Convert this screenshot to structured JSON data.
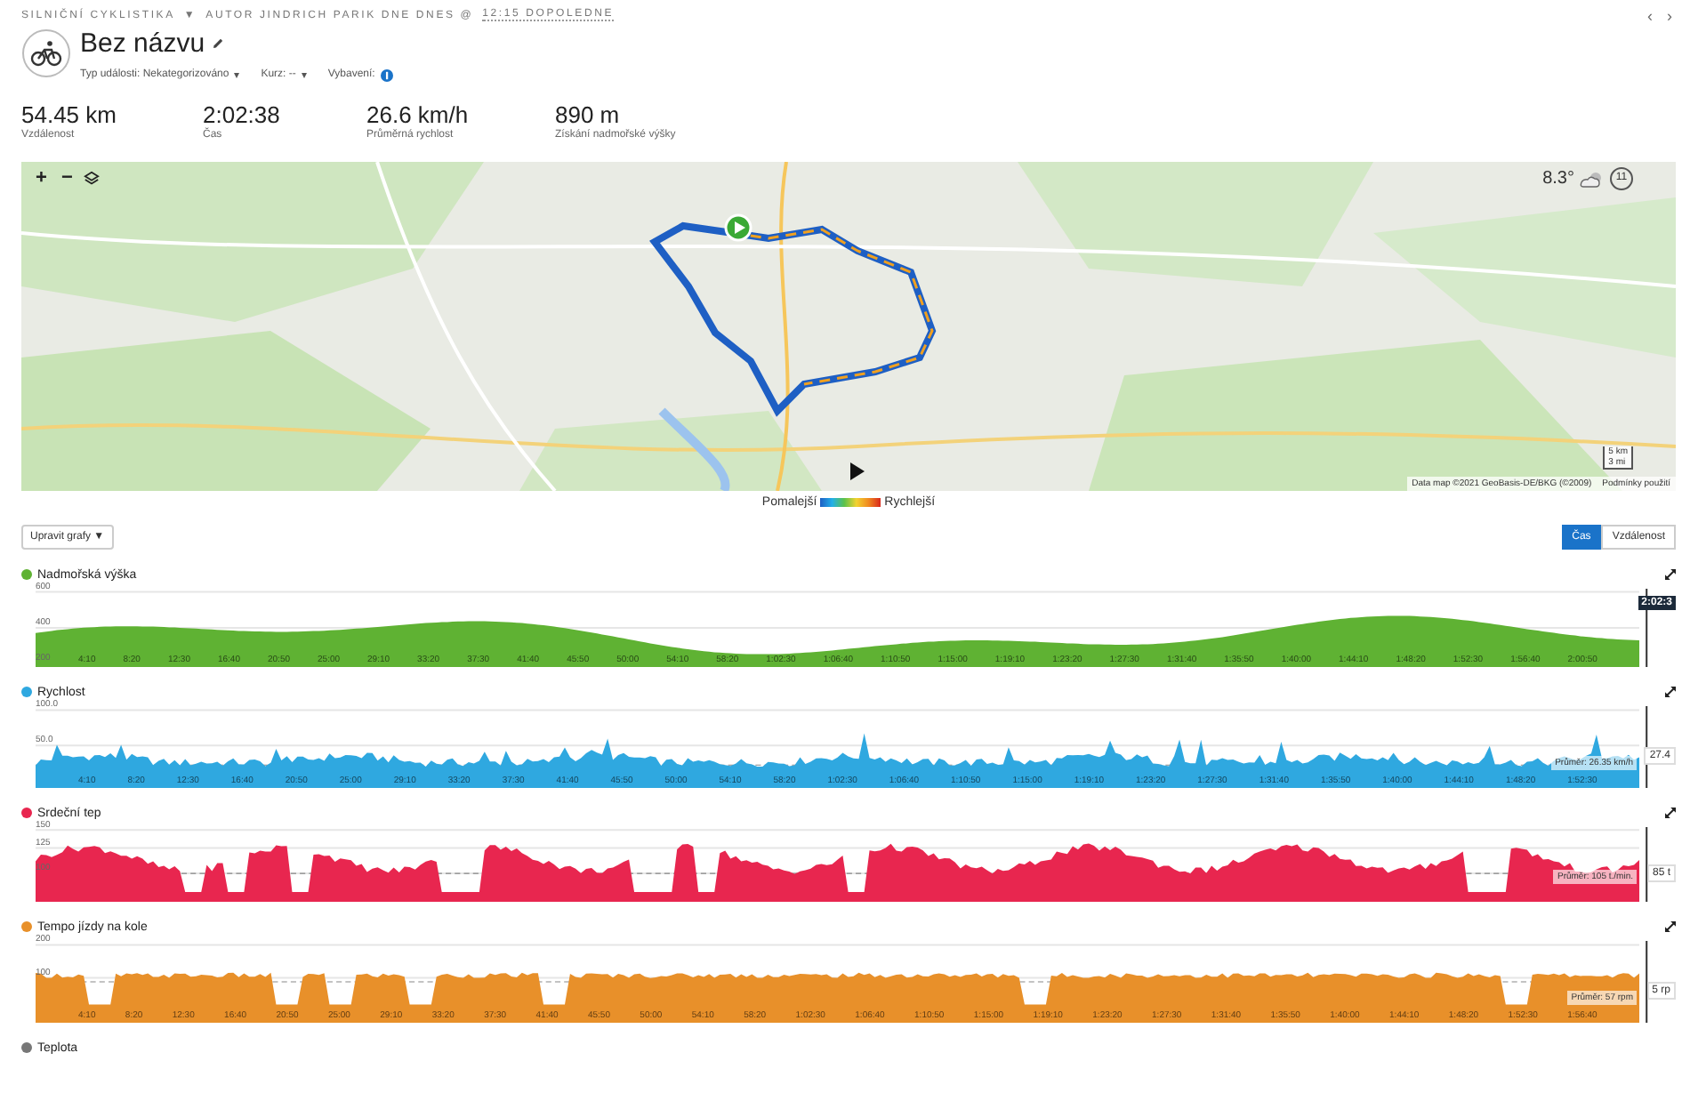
{
  "activity": {
    "type": "SILNIČNÍ CYKLISTIKA",
    "type_caret": "▼",
    "author": "AUTOR JINDRICH PARIK DNE DNES @",
    "time": "12:15 DOPOLEDNE",
    "title": "Bez názvu",
    "meta": [
      {
        "label": "Typ události: Nekategorizováno",
        "caret": "▾"
      },
      {
        "label": "Kurz: --",
        "caret": "▾"
      },
      {
        "label": "Vybavení:"
      }
    ],
    "pager": [
      "‹",
      "›"
    ]
  },
  "stats": [
    {
      "value": "54.45 km",
      "label": "Vzdálenost"
    },
    {
      "value": "2:02:38",
      "label": "Čas"
    },
    {
      "value": "26.6 km/h",
      "label": "Průměrná rychlost"
    },
    {
      "value": "890 m",
      "label": "Získání nadmořské výšky"
    }
  ],
  "map": {
    "zoom_in": "+",
    "zoom_out": "−",
    "temperature": "8.3°",
    "wind": "11",
    "scale": [
      "5 km",
      "3 mi"
    ],
    "attribution": "Data map ©2021 GeoBasis-DE/BKG (©2009)",
    "terms": "Podmínky použití"
  },
  "legend": {
    "slow": "Pomalejší",
    "fast": "Rychlejší"
  },
  "edit_button": {
    "label": "Upravit grafy",
    "caret": "▼"
  },
  "axis_toggle": [
    {
      "label": "Čas",
      "selected": true
    },
    {
      "label": "Vzdálenost",
      "selected": false
    }
  ],
  "charts": [
    {
      "kind": "elevation",
      "title": "Nadmořská výška",
      "color": "#5fb233",
      "y_ticks": [
        "600",
        "400",
        "200"
      ],
      "x_ticks": [
        "4:10",
        "8:20",
        "12:30",
        "16:40",
        "20:50",
        "25:00",
        "29:10",
        "33:20",
        "37:30",
        "41:40",
        "45:50",
        "50:00",
        "54:10",
        "58:20",
        "1:02:30",
        "1:06:40",
        "1:10:50",
        "1:15:00",
        "1:19:10",
        "1:23:20",
        "1:27:30",
        "1:31:40",
        "1:35:50",
        "1:40:00",
        "1:44:10",
        "1:48:20",
        "1:52:30",
        "1:56:40",
        "2:00:50"
      ],
      "cursor_value": "2:02:3"
    },
    {
      "kind": "speed",
      "title": "Rychlost",
      "color": "#2fa8e0",
      "y_ticks": [
        "100.0",
        "50.0"
      ],
      "x_ticks": [
        "4:10",
        "8:20",
        "12:30",
        "16:40",
        "20:50",
        "25:00",
        "29:10",
        "33:20",
        "37:30",
        "41:40",
        "45:50",
        "50:00",
        "54:10",
        "58:20",
        "1:02:30",
        "1:06:40",
        "1:10:50",
        "1:15:00",
        "1:19:10",
        "1:23:20",
        "1:27:30",
        "1:31:40",
        "1:35:50",
        "1:40:00",
        "1:44:10",
        "1:48:20",
        "1:52:30"
      ],
      "cursor_value": "27.4",
      "average": "Průměr: 26.35 km/h"
    },
    {
      "kind": "heart_rate",
      "title": "Srdeční tep",
      "color": "#e8264f",
      "y_ticks": [
        "150",
        "125",
        "100"
      ],
      "cursor_value": "85 t",
      "average": "Průměr: 105 t./min."
    },
    {
      "kind": "cadence",
      "title": "Tempo jízdy na kole",
      "color": "#e8902a",
      "y_ticks": [
        "200",
        "100"
      ],
      "x_ticks": [
        "4:10",
        "8:20",
        "12:30",
        "16:40",
        "20:50",
        "25:00",
        "29:10",
        "33:20",
        "37:30",
        "41:40",
        "45:50",
        "50:00",
        "54:10",
        "58:20",
        "1:02:30",
        "1:06:40",
        "1:10:50",
        "1:15:00",
        "1:19:10",
        "1:23:20",
        "1:27:30",
        "1:31:40",
        "1:35:50",
        "1:40:00",
        "1:44:10",
        "1:48:20",
        "1:52:30",
        "1:56:40"
      ],
      "cursor_value": "5 rp",
      "average": "Průměr: 57 rpm"
    },
    {
      "kind": "collapsed",
      "title": "Teplota",
      "color": "#777777"
    }
  ]
}
